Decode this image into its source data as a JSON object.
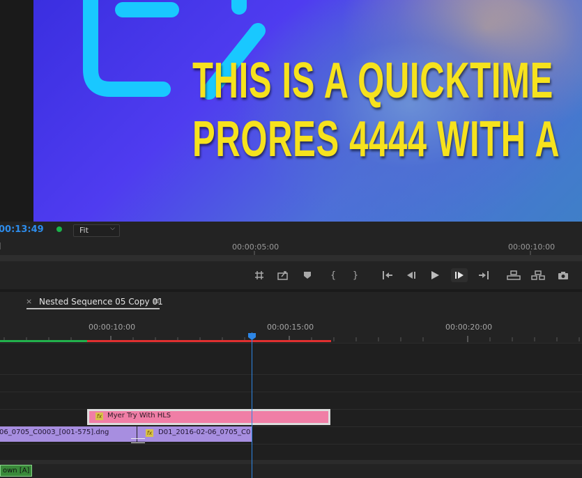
{
  "monitor": {
    "video_text": "THIS IS A QUICKTIME\nPRORES 4444 WITH A",
    "timecode": "00:13:49",
    "fit_label": "Fit",
    "ruler_ticks": [
      "00:00:05:00",
      "00:00:10:00"
    ]
  },
  "timeline": {
    "tab_close": "×",
    "tab_title": "Nested Sequence 05 Copy 01",
    "tab_menu": "≡",
    "ruler_ticks": [
      "00:00:10:00",
      "00:00:15:00",
      "00:00:20:00"
    ],
    "clips": {
      "pink_name": "Myer Try With HLS",
      "fx_label": "fx",
      "purple1_name": "06_0705_C0003_[001-575].dng",
      "purple2_name": "D01_2016-02-06_0705_C0"
    },
    "audio_label": "own [A]"
  },
  "colors": {
    "timecode_blue": "#2d86e6",
    "video_text_yellow": "#f6e21d",
    "clip_pink": "#f07ea6",
    "clip_purple": "#a78ee0",
    "render_bar_green": "#22b14c",
    "render_bar_red": "#e03030"
  },
  "icons": [
    "safe-margins-icon",
    "export-frame-icon",
    "add-marker-icon",
    "mark-in-icon",
    "mark-out-icon",
    "go-to-in-icon",
    "step-back-icon",
    "play-icon",
    "step-forward-icon",
    "go-to-out-icon",
    "lift-icon",
    "extract-icon",
    "camera-icon"
  ]
}
